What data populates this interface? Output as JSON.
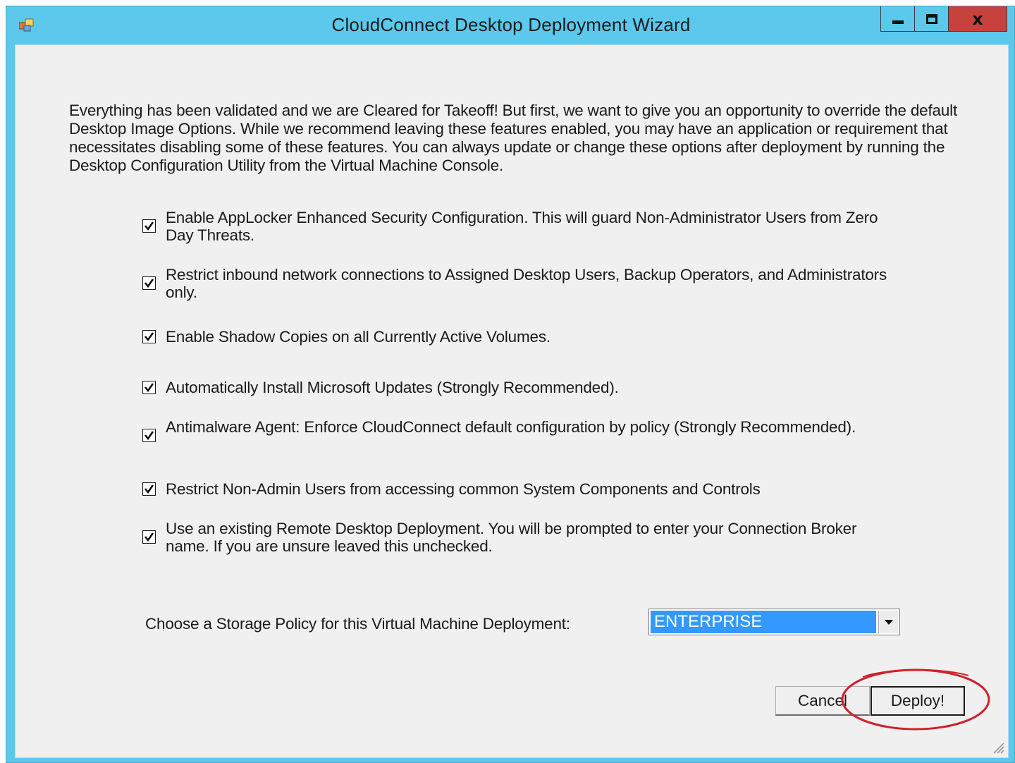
{
  "window": {
    "title": "CloudConnect Desktop Deployment Wizard",
    "icon": "application-icon",
    "controls": {
      "minimize_icon": "minimize-icon",
      "maximize_icon": "maximize-icon",
      "close_label": "x"
    }
  },
  "intro": {
    "text": "Everything has been validated and we are Cleared for Takeoff!  But first, we want to give you an opportunity to override the default Desktop Image Options.  While we recommend leaving these features enabled, you may have an application or requirement that necessitates disabling some of these features.  You can always update or change these options after deployment by running the Desktop Configuration Utility from the Virtual Machine Console."
  },
  "options": [
    {
      "label": "Enable AppLocker Enhanced Security Configuration.  This will guard Non-Administrator Users from Zero Day Threats.",
      "checked": true
    },
    {
      "label": "Restrict inbound network connections to Assigned Desktop Users, Backup Operators, and Administrators only.",
      "checked": true
    },
    {
      "label": "Enable Shadow Copies on all Currently Active Volumes.",
      "checked": true
    },
    {
      "label": "Automatically Install Microsoft Updates (Strongly Recommended).",
      "checked": true
    },
    {
      "label": "Antimalware Agent: Enforce CloudConnect default configuration by policy (Strongly Recommended).",
      "checked": true
    },
    {
      "label": "Restrict Non-Admin Users from accessing common System Components and Controls",
      "checked": true
    },
    {
      "label": "Use an existing Remote Desktop Deployment.  You will be prompted to enter your Connection Broker name.  If you are unsure leaved this unchecked.",
      "checked": true
    }
  ],
  "storage": {
    "label": "Choose a Storage Policy for this Virtual Machine Deployment:",
    "selected": "ENTERPRISE"
  },
  "buttons": {
    "cancel": "Cancel",
    "deploy": "Deploy!"
  },
  "colors": {
    "title_bar": "#5bc8ec",
    "close_button": "#c7423c",
    "selection": "#3399ff",
    "annotation": "#d0202a"
  }
}
